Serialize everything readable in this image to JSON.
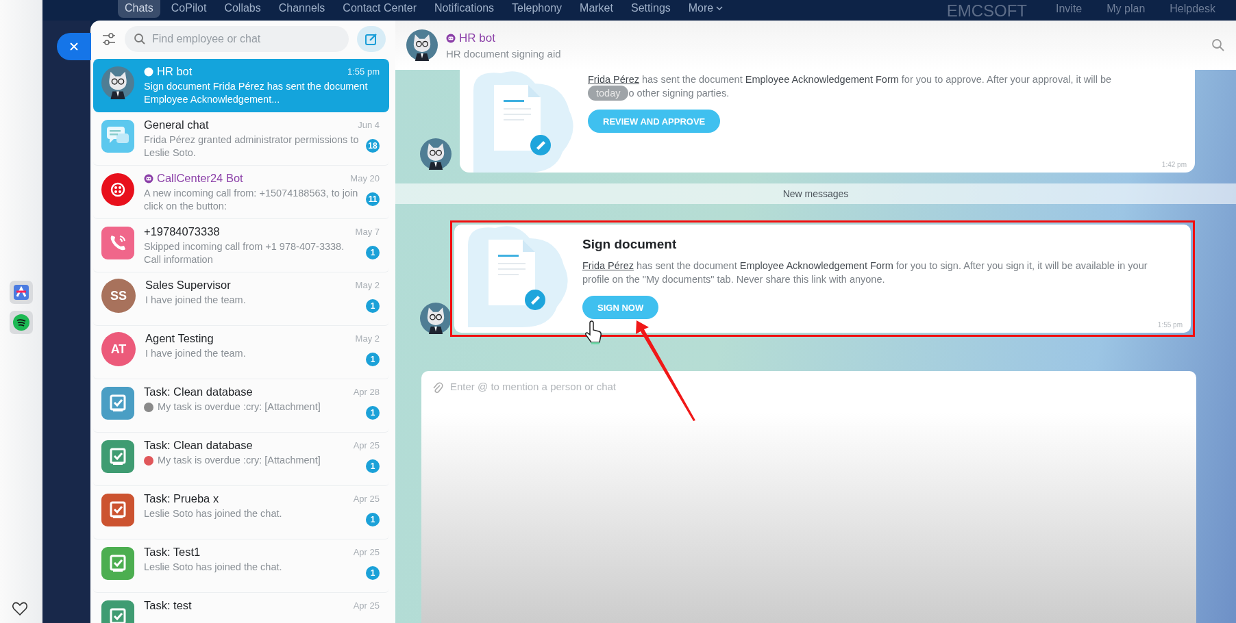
{
  "top_nav": {
    "items": [
      {
        "label": "Chats",
        "selected": true
      },
      {
        "label": "CoPilot",
        "selected": false
      },
      {
        "label": "Collabs",
        "selected": false
      },
      {
        "label": "Channels",
        "selected": false
      },
      {
        "label": "Contact Center",
        "selected": false
      },
      {
        "label": "Notifications",
        "selected": false
      },
      {
        "label": "Telephony",
        "selected": false
      },
      {
        "label": "Market",
        "selected": false
      },
      {
        "label": "Settings",
        "selected": false
      },
      {
        "label": "More",
        "selected": false
      }
    ],
    "company": "EMCSOFT",
    "links": [
      "Invite",
      "My plan",
      "Helpdesk"
    ]
  },
  "chat_list": {
    "search": {
      "placeholder": "Find employee or chat"
    },
    "items": [
      {
        "kind": "bot",
        "title": "HR bot",
        "bot": true,
        "preview": "Sign document Frida Pérez has sent the document Employee Acknowledgement...",
        "time": "1:55 pm",
        "selected": true
      },
      {
        "kind": "group",
        "title": "General chat",
        "bot": false,
        "preview": "Frida Pérez granted administrator permissions to Leslie Soto.",
        "time": "Jun 4",
        "unread": "18",
        "selected": false
      },
      {
        "kind": "callcenter",
        "title": "CallCenter24 Bot",
        "bot": true,
        "preview": "A new incoming call from: +15074188563, to join click on the button:",
        "time": "May 20",
        "unread": "11",
        "selected": false
      },
      {
        "kind": "phone",
        "title": "+19784073338",
        "bot": false,
        "preview": "Skipped incoming call from +1 978-407-3338. Call information",
        "time": "May 7",
        "unread": "1",
        "selected": false
      },
      {
        "kind": "initials",
        "title": "Sales Supervisor",
        "initials": "SS",
        "color": "#a8725c",
        "bot": false,
        "preview": "I have joined the team.",
        "time": "May 2",
        "unread": "1",
        "selected": false
      },
      {
        "kind": "initials",
        "title": "Agent Testing",
        "initials": "AT",
        "color": "#ec5a7a",
        "bot": false,
        "preview": "I have joined the team.",
        "time": "May 2",
        "unread": "1",
        "selected": false
      },
      {
        "kind": "task",
        "title": "Task: Clean database",
        "color": "#4a9ec4",
        "bot": false,
        "preview_avatar": {
          "color": "#8a8a8a"
        },
        "preview": "My task is overdue :cry: [Attachment]",
        "time": "Apr 28",
        "unread": "1",
        "selected": false
      },
      {
        "kind": "task",
        "title": "Task: Clean database",
        "color": "#3f9c72",
        "bot": false,
        "preview_avatar": {
          "color": "#e0575a"
        },
        "preview": "My task is overdue :cry: [Attachment]",
        "time": "Apr 25",
        "unread": "1",
        "selected": false
      },
      {
        "kind": "task",
        "title": "Task: Prueba x",
        "color": "#cc5330",
        "bot": false,
        "preview": "Leslie Soto has joined the chat.",
        "time": "Apr 25",
        "unread": "1",
        "selected": false
      },
      {
        "kind": "task",
        "title": "Task: Test1",
        "color": "#4cae50",
        "bot": false,
        "preview": "Leslie Soto has joined the chat.",
        "time": "Apr 25",
        "unread": "1",
        "selected": false
      },
      {
        "kind": "task",
        "title": "Task: test",
        "color": "#3f9c72",
        "bot": false,
        "time": "Apr 25",
        "selected": false
      }
    ]
  },
  "chat": {
    "title": "HR bot",
    "subtitle": "HR document signing aid",
    "messages": [
      {
        "kind": "document",
        "author": "Frida Pérez",
        "text": "has sent the document **Employee Acknowledgement Form** for you to approve. After your approval, it will be",
        "date_pill": "today",
        "text_after": "o other signing parties.",
        "button": "REVIEW AND APPROVE",
        "time": "1:42 pm",
        "highlighted": false
      },
      {
        "kind": "divider",
        "label": "New messages"
      },
      {
        "kind": "document",
        "title": "Sign document",
        "author": "Frida Pérez",
        "text": "has sent the document **Employee Acknowledgement Form** for you to sign. After you sign it, it will be available in your profile on the \"My documents\" tab. Never share this link with anyone.",
        "button": "SIGN NOW",
        "time": "1:55 pm",
        "highlighted": true
      }
    ],
    "composer": {
      "placeholder": "Enter @ to mention a person or chat"
    }
  }
}
